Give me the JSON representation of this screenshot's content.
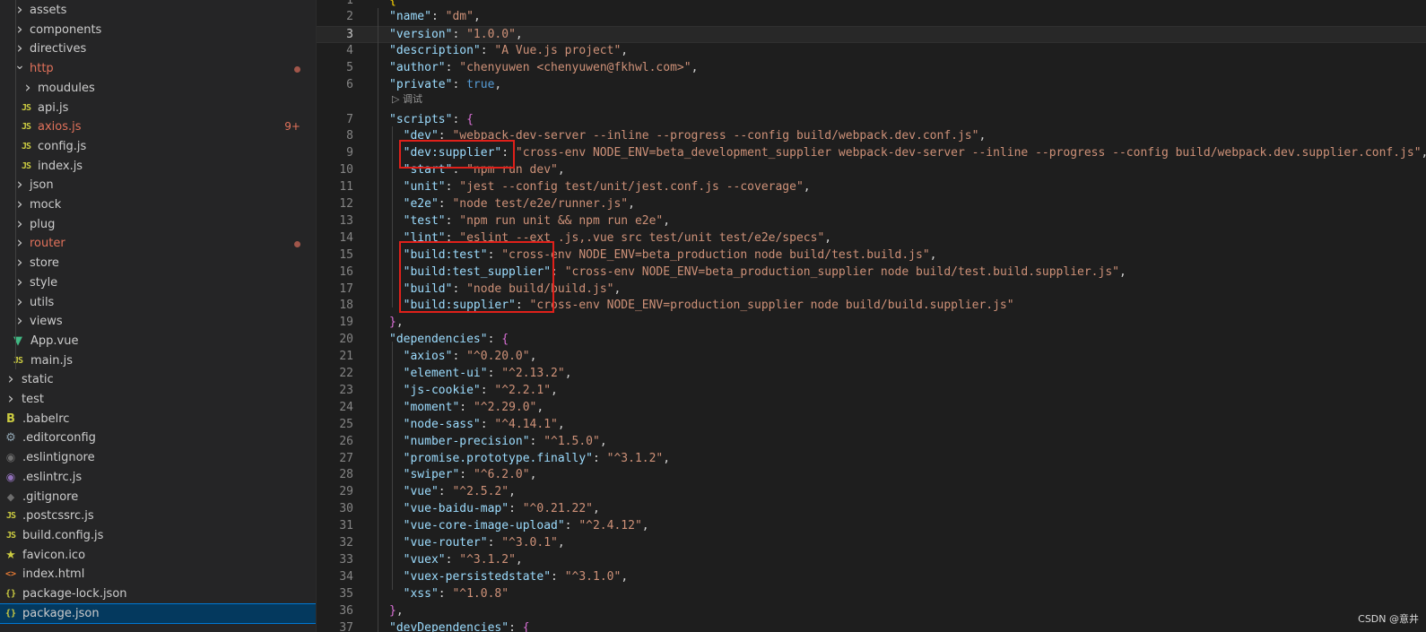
{
  "explorer": {
    "items": [
      {
        "label": "assets",
        "type": "folder"
      },
      {
        "label": "components",
        "type": "folder"
      },
      {
        "label": "directives",
        "type": "folder"
      },
      {
        "label": "http",
        "type": "folder-open",
        "modified": true
      },
      {
        "label": "moudules",
        "type": "folder"
      },
      {
        "label": "api.js",
        "type": "js",
        "icon_text": "JS"
      },
      {
        "label": "axios.js",
        "type": "js",
        "icon_text": "JS",
        "modified": true,
        "problems": "9+"
      },
      {
        "label": "config.js",
        "type": "js",
        "icon_text": "JS"
      },
      {
        "label": "index.js",
        "type": "js",
        "icon_text": "JS"
      },
      {
        "label": "json",
        "type": "folder"
      },
      {
        "label": "mock",
        "type": "folder"
      },
      {
        "label": "plug",
        "type": "folder"
      },
      {
        "label": "router",
        "type": "folder",
        "modified": true
      },
      {
        "label": "store",
        "type": "folder"
      },
      {
        "label": "style",
        "type": "folder"
      },
      {
        "label": "utils",
        "type": "folder"
      },
      {
        "label": "views",
        "type": "folder"
      },
      {
        "label": "App.vue",
        "type": "vue"
      },
      {
        "label": "main.js",
        "type": "js",
        "icon_text": "JS"
      },
      {
        "label": "static",
        "type": "folder"
      },
      {
        "label": "test",
        "type": "folder"
      },
      {
        "label": ".babelrc",
        "type": "babel"
      },
      {
        "label": ".editorconfig",
        "type": "gear"
      },
      {
        "label": ".eslintignore",
        "type": "ignore"
      },
      {
        "label": ".eslintrc.js",
        "type": "eslint"
      },
      {
        "label": ".gitignore",
        "type": "git"
      },
      {
        "label": ".postcssrc.js",
        "type": "js",
        "icon_text": "JS"
      },
      {
        "label": "build.config.js",
        "type": "js",
        "icon_text": "JS"
      },
      {
        "label": "favicon.ico",
        "type": "star"
      },
      {
        "label": "index.html",
        "type": "html",
        "icon_text": "<>"
      },
      {
        "label": "package-lock.json",
        "type": "json",
        "icon_text": "{}"
      },
      {
        "label": "package.json",
        "type": "json",
        "icon_text": "{}",
        "selected": true
      }
    ]
  },
  "editor": {
    "codelens": "▷ 调试",
    "lines": [
      {
        "n": "1",
        "tokens": [
          [
            "b2",
            "{"
          ]
        ]
      },
      {
        "n": "2",
        "tokens": [
          [
            "k",
            "\"name\""
          ],
          [
            "p",
            ": "
          ],
          [
            "s",
            "\"dm\""
          ],
          [
            "p",
            ","
          ]
        ]
      },
      {
        "n": "3",
        "tokens": [
          [
            "k",
            "\"version\""
          ],
          [
            "p",
            ": "
          ],
          [
            "s",
            "\"1.0.0\""
          ],
          [
            "p",
            ","
          ]
        ],
        "current": true
      },
      {
        "n": "4",
        "tokens": [
          [
            "k",
            "\"description\""
          ],
          [
            "p",
            ": "
          ],
          [
            "s",
            "\"A Vue.js project\""
          ],
          [
            "p",
            ","
          ]
        ]
      },
      {
        "n": "5",
        "tokens": [
          [
            "k",
            "\"author\""
          ],
          [
            "p",
            ": "
          ],
          [
            "s",
            "\"chenyuwen <chenyuwen@fkhwl.com>\""
          ],
          [
            "p",
            ","
          ]
        ]
      },
      {
        "n": "6",
        "tokens": [
          [
            "k",
            "\"private\""
          ],
          [
            "p",
            ": "
          ],
          [
            "kw",
            "true"
          ],
          [
            "p",
            ","
          ]
        ]
      },
      {
        "n": "7",
        "tokens": [
          [
            "k",
            "\"scripts\""
          ],
          [
            "p",
            ": "
          ],
          [
            "b",
            "{"
          ]
        ]
      },
      {
        "n": "8",
        "tokens": [
          [
            "p",
            "  "
          ],
          [
            "k",
            "\"dev\""
          ],
          [
            "p",
            ": "
          ],
          [
            "s",
            "\"webpack-dev-server --inline --progress --config build/webpack.dev.conf.js\""
          ],
          [
            "p",
            ","
          ]
        ]
      },
      {
        "n": "9",
        "tokens": [
          [
            "p",
            "  "
          ],
          [
            "k",
            "\"dev:supplier\""
          ],
          [
            "p",
            ": "
          ],
          [
            "s",
            "\"cross-env NODE_ENV=beta_development_supplier webpack-dev-server --inline --progress --config build/webpack.dev.supplier.conf.js\""
          ],
          [
            "p",
            ","
          ]
        ]
      },
      {
        "n": "10",
        "tokens": [
          [
            "p",
            "  "
          ],
          [
            "k",
            "\"start\""
          ],
          [
            "p",
            ": "
          ],
          [
            "s",
            "\"npm run dev\""
          ],
          [
            "p",
            ","
          ]
        ]
      },
      {
        "n": "11",
        "tokens": [
          [
            "p",
            "  "
          ],
          [
            "k",
            "\"unit\""
          ],
          [
            "p",
            ": "
          ],
          [
            "s",
            "\"jest --config test/unit/jest.conf.js --coverage\""
          ],
          [
            "p",
            ","
          ]
        ]
      },
      {
        "n": "12",
        "tokens": [
          [
            "p",
            "  "
          ],
          [
            "k",
            "\"e2e\""
          ],
          [
            "p",
            ": "
          ],
          [
            "s",
            "\"node test/e2e/runner.js\""
          ],
          [
            "p",
            ","
          ]
        ]
      },
      {
        "n": "13",
        "tokens": [
          [
            "p",
            "  "
          ],
          [
            "k",
            "\"test\""
          ],
          [
            "p",
            ": "
          ],
          [
            "s",
            "\"npm run unit && npm run e2e\""
          ],
          [
            "p",
            ","
          ]
        ]
      },
      {
        "n": "14",
        "tokens": [
          [
            "p",
            "  "
          ],
          [
            "k",
            "\"lint\""
          ],
          [
            "p",
            ": "
          ],
          [
            "s",
            "\"eslint --ext .js,.vue src test/unit test/e2e/specs\""
          ],
          [
            "p",
            ","
          ]
        ]
      },
      {
        "n": "15",
        "tokens": [
          [
            "p",
            "  "
          ],
          [
            "k",
            "\"build:test\""
          ],
          [
            "p",
            ": "
          ],
          [
            "s",
            "\"cross-env NODE_ENV=beta_production node build/test.build.js\""
          ],
          [
            "p",
            ","
          ]
        ]
      },
      {
        "n": "16",
        "tokens": [
          [
            "p",
            "  "
          ],
          [
            "k",
            "\"build:test_supplier\""
          ],
          [
            "p",
            ": "
          ],
          [
            "s",
            "\"cross-env NODE_ENV=beta_production_supplier node build/test.build.supplier.js\""
          ],
          [
            "p",
            ","
          ]
        ]
      },
      {
        "n": "17",
        "tokens": [
          [
            "p",
            "  "
          ],
          [
            "k",
            "\"build\""
          ],
          [
            "p",
            ": "
          ],
          [
            "s",
            "\"node build/build.js\""
          ],
          [
            "p",
            ","
          ]
        ]
      },
      {
        "n": "18",
        "tokens": [
          [
            "p",
            "  "
          ],
          [
            "k",
            "\"build:supplier\""
          ],
          [
            "p",
            ": "
          ],
          [
            "s",
            "\"cross-env NODE_ENV=production_supplier node build/build.supplier.js\""
          ]
        ]
      },
      {
        "n": "19",
        "tokens": [
          [
            "b",
            "}"
          ],
          [
            "p",
            ","
          ]
        ]
      },
      {
        "n": "20",
        "tokens": [
          [
            "k",
            "\"dependencies\""
          ],
          [
            "p",
            ": "
          ],
          [
            "b",
            "{"
          ]
        ]
      },
      {
        "n": "21",
        "tokens": [
          [
            "p",
            "  "
          ],
          [
            "k",
            "\"axios\""
          ],
          [
            "p",
            ": "
          ],
          [
            "s",
            "\"^0.20.0\""
          ],
          [
            "p",
            ","
          ]
        ]
      },
      {
        "n": "22",
        "tokens": [
          [
            "p",
            "  "
          ],
          [
            "k",
            "\"element-ui\""
          ],
          [
            "p",
            ": "
          ],
          [
            "s",
            "\"^2.13.2\""
          ],
          [
            "p",
            ","
          ]
        ]
      },
      {
        "n": "23",
        "tokens": [
          [
            "p",
            "  "
          ],
          [
            "k",
            "\"js-cookie\""
          ],
          [
            "p",
            ": "
          ],
          [
            "s",
            "\"^2.2.1\""
          ],
          [
            "p",
            ","
          ]
        ]
      },
      {
        "n": "24",
        "tokens": [
          [
            "p",
            "  "
          ],
          [
            "k",
            "\"moment\""
          ],
          [
            "p",
            ": "
          ],
          [
            "s",
            "\"^2.29.0\""
          ],
          [
            "p",
            ","
          ]
        ]
      },
      {
        "n": "25",
        "tokens": [
          [
            "p",
            "  "
          ],
          [
            "k",
            "\"node-sass\""
          ],
          [
            "p",
            ": "
          ],
          [
            "s",
            "\"^4.14.1\""
          ],
          [
            "p",
            ","
          ]
        ]
      },
      {
        "n": "26",
        "tokens": [
          [
            "p",
            "  "
          ],
          [
            "k",
            "\"number-precision\""
          ],
          [
            "p",
            ": "
          ],
          [
            "s",
            "\"^1.5.0\""
          ],
          [
            "p",
            ","
          ]
        ]
      },
      {
        "n": "27",
        "tokens": [
          [
            "p",
            "  "
          ],
          [
            "k",
            "\"promise.prototype.finally\""
          ],
          [
            "p",
            ": "
          ],
          [
            "s",
            "\"^3.1.2\""
          ],
          [
            "p",
            ","
          ]
        ]
      },
      {
        "n": "28",
        "tokens": [
          [
            "p",
            "  "
          ],
          [
            "k",
            "\"swiper\""
          ],
          [
            "p",
            ": "
          ],
          [
            "s",
            "\"^6.2.0\""
          ],
          [
            "p",
            ","
          ]
        ]
      },
      {
        "n": "29",
        "tokens": [
          [
            "p",
            "  "
          ],
          [
            "k",
            "\"vue\""
          ],
          [
            "p",
            ": "
          ],
          [
            "s",
            "\"^2.5.2\""
          ],
          [
            "p",
            ","
          ]
        ]
      },
      {
        "n": "30",
        "tokens": [
          [
            "p",
            "  "
          ],
          [
            "k",
            "\"vue-baidu-map\""
          ],
          [
            "p",
            ": "
          ],
          [
            "s",
            "\"^0.21.22\""
          ],
          [
            "p",
            ","
          ]
        ]
      },
      {
        "n": "31",
        "tokens": [
          [
            "p",
            "  "
          ],
          [
            "k",
            "\"vue-core-image-upload\""
          ],
          [
            "p",
            ": "
          ],
          [
            "s",
            "\"^2.4.12\""
          ],
          [
            "p",
            ","
          ]
        ]
      },
      {
        "n": "32",
        "tokens": [
          [
            "p",
            "  "
          ],
          [
            "k",
            "\"vue-router\""
          ],
          [
            "p",
            ": "
          ],
          [
            "s",
            "\"^3.0.1\""
          ],
          [
            "p",
            ","
          ]
        ]
      },
      {
        "n": "33",
        "tokens": [
          [
            "p",
            "  "
          ],
          [
            "k",
            "\"vuex\""
          ],
          [
            "p",
            ": "
          ],
          [
            "s",
            "\"^3.1.2\""
          ],
          [
            "p",
            ","
          ]
        ]
      },
      {
        "n": "34",
        "tokens": [
          [
            "p",
            "  "
          ],
          [
            "k",
            "\"vuex-persistedstate\""
          ],
          [
            "p",
            ": "
          ],
          [
            "s",
            "\"^3.1.0\""
          ],
          [
            "p",
            ","
          ]
        ]
      },
      {
        "n": "35",
        "tokens": [
          [
            "p",
            "  "
          ],
          [
            "k",
            "\"xss\""
          ],
          [
            "p",
            ": "
          ],
          [
            "s",
            "\"^1.0.8\""
          ]
        ]
      },
      {
        "n": "36",
        "tokens": [
          [
            "b",
            "}"
          ],
          [
            "p",
            ","
          ]
        ]
      },
      {
        "n": "37",
        "tokens": [
          [
            "k",
            "\"devDependencies\""
          ],
          [
            "p",
            ": "
          ],
          [
            "b",
            "{"
          ]
        ]
      }
    ]
  },
  "watermark": "CSDN @意井",
  "colors": {
    "background": "#1e1e1e",
    "sidebar": "#252526",
    "selection": "#04395e",
    "json_key": "#9cdcfe",
    "json_string": "#ce9178",
    "json_keyword": "#569cd6",
    "modified": "#e2725b",
    "highlight_box": "#e0201a"
  }
}
